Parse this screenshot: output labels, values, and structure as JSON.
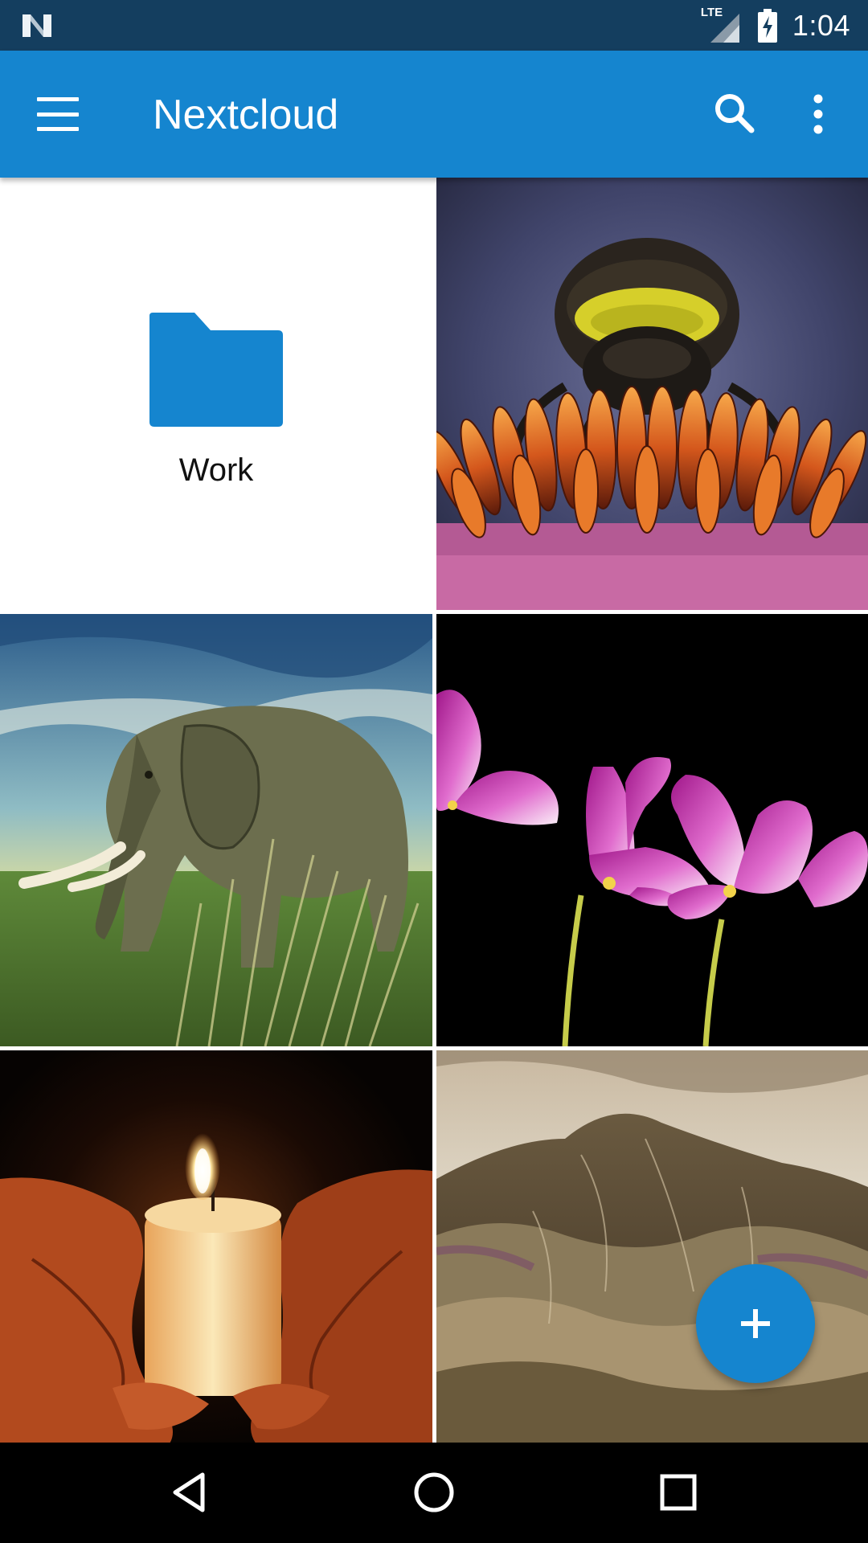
{
  "status_bar": {
    "network_label": "LTE",
    "time": "1:04",
    "icons": [
      "n-logo-icon",
      "signal-icon",
      "battery-charging-icon"
    ]
  },
  "app_bar": {
    "title": "Nextcloud",
    "icons": [
      "menu-icon",
      "search-icon",
      "more-vert-icon"
    ]
  },
  "grid": {
    "folder": {
      "label": "Work",
      "icon": "folder-icon"
    },
    "thumbnails": [
      "bee-on-flower",
      "elephant-in-grass",
      "pink-cosmos-flowers",
      "candle-in-hands",
      "rolling-hills"
    ]
  },
  "fab": {
    "icon": "add-icon"
  },
  "nav_bar": {
    "icons": [
      "back-icon",
      "home-icon",
      "recents-icon"
    ]
  },
  "colors": {
    "status_bar": "#143e5f",
    "app_bar": "#1585cf",
    "accent": "#1585cf",
    "nav_bar": "#000000"
  }
}
